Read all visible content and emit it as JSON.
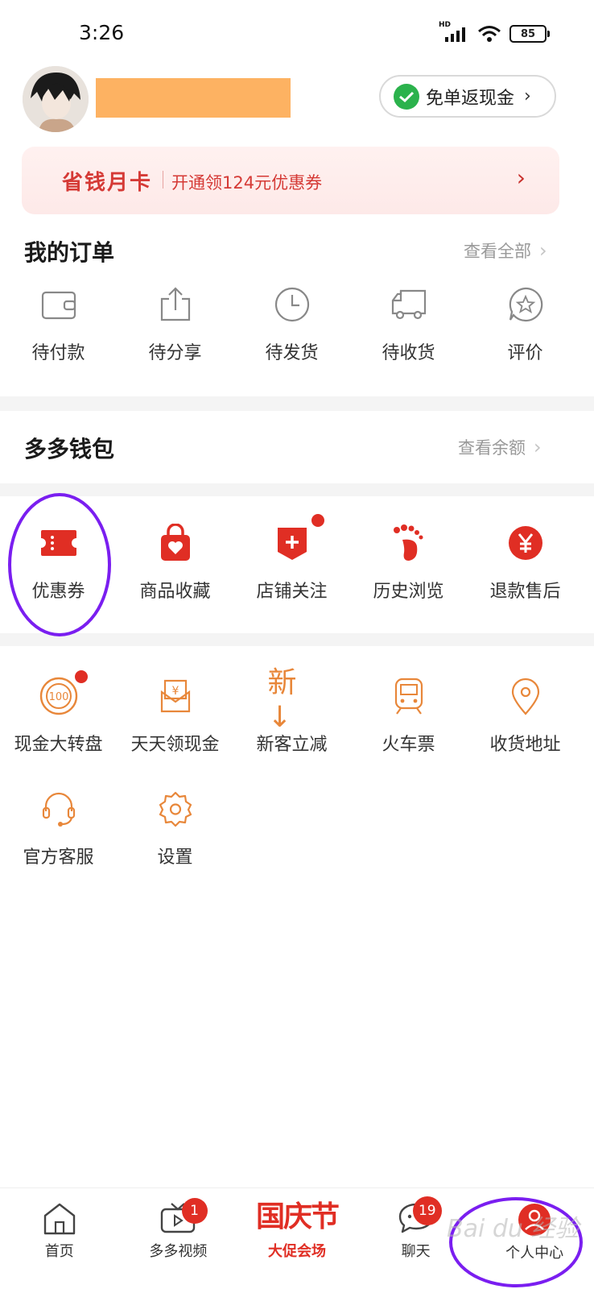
{
  "status_bar": {
    "time": "3:26",
    "network": "HD",
    "battery": "85"
  },
  "header": {
    "cashback_label": "免单返现金",
    "card_title": "省钱月卡",
    "card_subtitle": "开通领124元优惠券"
  },
  "orders": {
    "title": "我的订单",
    "link": "查看全部",
    "items": [
      {
        "label": "待付款",
        "icon": "wallet-icon"
      },
      {
        "label": "待分享",
        "icon": "share-icon"
      },
      {
        "label": "待发货",
        "icon": "clock-icon"
      },
      {
        "label": "待收货",
        "icon": "truck-icon"
      },
      {
        "label": "评价",
        "icon": "review-star-icon"
      }
    ]
  },
  "wallet": {
    "title": "多多钱包",
    "link": "查看余额"
  },
  "quick_tools": [
    {
      "label": "优惠券",
      "icon": "coupon-icon"
    },
    {
      "label": "商品收藏",
      "icon": "favorite-bag-icon"
    },
    {
      "label": "店铺关注",
      "icon": "store-follow-icon"
    },
    {
      "label": "历史浏览",
      "icon": "footprint-icon"
    },
    {
      "label": "退款售后",
      "icon": "refund-yen-icon"
    }
  ],
  "services": [
    {
      "label": "现金大转盘",
      "icon": "wheel-100-icon",
      "glyph": "100"
    },
    {
      "label": "天天领现金",
      "icon": "cash-envelope-icon",
      "glyph": "¥"
    },
    {
      "label": "新客立减",
      "icon": "new-customer-icon",
      "glyph": "新↓"
    },
    {
      "label": "火车票",
      "icon": "train-icon"
    },
    {
      "label": "收货地址",
      "icon": "location-pin-icon"
    },
    {
      "label": "官方客服",
      "icon": "headset-icon"
    },
    {
      "label": "设置",
      "icon": "settings-gear-icon"
    }
  ],
  "bottom_nav": [
    {
      "label": "首页",
      "icon": "home-icon"
    },
    {
      "label": "多多视频",
      "icon": "video-tv-icon",
      "badge": "1"
    },
    {
      "label": "大促会场",
      "icon": "national-day-logo",
      "logo_text": "国庆节"
    },
    {
      "label": "聊天",
      "icon": "chat-bubble-icon",
      "badge": "19"
    },
    {
      "label": "个人中心",
      "icon": "profile-icon"
    }
  ],
  "watermark": "Bai du 经验",
  "colors": {
    "accent": "#e02e24",
    "orange_icon": "#e8873a",
    "highlight_ring": "#7a1ef0",
    "wechat_green": "#2bb24c"
  }
}
